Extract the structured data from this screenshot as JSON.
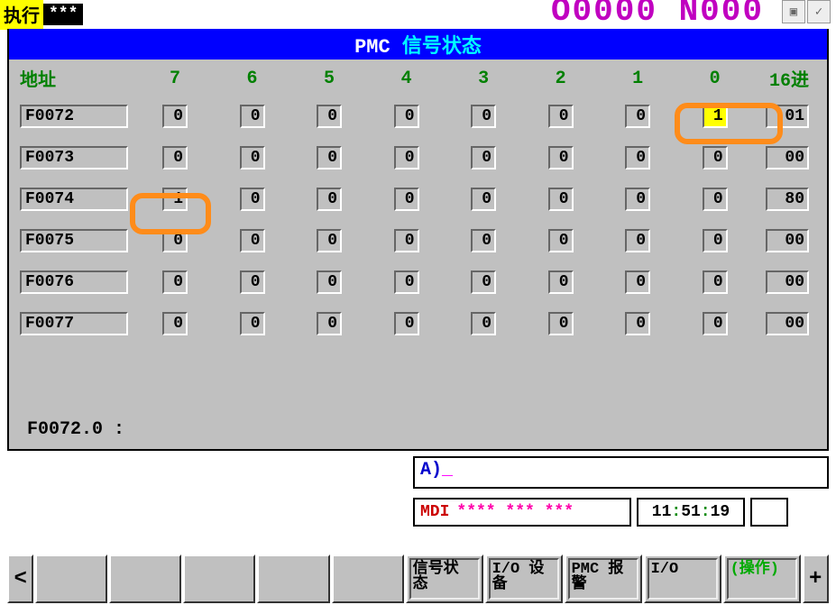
{
  "top": {
    "exec_label": "执行",
    "exec_stars": "***",
    "counter": "O0000 N000"
  },
  "title": {
    "prefix": "PMC",
    "text": "信号状态"
  },
  "headers": {
    "addr": "地址",
    "bits": [
      "7",
      "6",
      "5",
      "4",
      "3",
      "2",
      "1",
      "0"
    ],
    "hex": "16进"
  },
  "rows": [
    {
      "addr": "F0072",
      "bits": [
        "0",
        "0",
        "0",
        "0",
        "0",
        "0",
        "0",
        "1"
      ],
      "hex": "01",
      "hl_bit": 7
    },
    {
      "addr": "F0073",
      "bits": [
        "0",
        "0",
        "0",
        "0",
        "0",
        "0",
        "0",
        "0"
      ],
      "hex": "00"
    },
    {
      "addr": "F0074",
      "bits": [
        "1",
        "0",
        "0",
        "0",
        "0",
        "0",
        "0",
        "0"
      ],
      "hex": "80"
    },
    {
      "addr": "F0075",
      "bits": [
        "0",
        "0",
        "0",
        "0",
        "0",
        "0",
        "0",
        "0"
      ],
      "hex": "00"
    },
    {
      "addr": "F0076",
      "bits": [
        "0",
        "0",
        "0",
        "0",
        "0",
        "0",
        "0",
        "0"
      ],
      "hex": "00"
    },
    {
      "addr": "F0077",
      "bits": [
        "0",
        "0",
        "0",
        "0",
        "0",
        "0",
        "0",
        "0"
      ],
      "hex": "00"
    }
  ],
  "status_line": "F0072.0 :",
  "prompt": {
    "a": "A)",
    "cursor": "_"
  },
  "mode": {
    "label": "MDI",
    "stars": "**** *** ***"
  },
  "time": {
    "h": "11",
    "m": "51",
    "s": "19"
  },
  "softkeys": {
    "left_arrow": "<",
    "right_plus": "+",
    "sk1_line1": "信号状",
    "sk1_line2": "态",
    "sk2_line1": "I/O 设",
    "sk2_line2": "备",
    "sk3_line1": "PMC 报",
    "sk3_line2": "警",
    "sk4": "I/O",
    "sk5": "(操作)"
  }
}
